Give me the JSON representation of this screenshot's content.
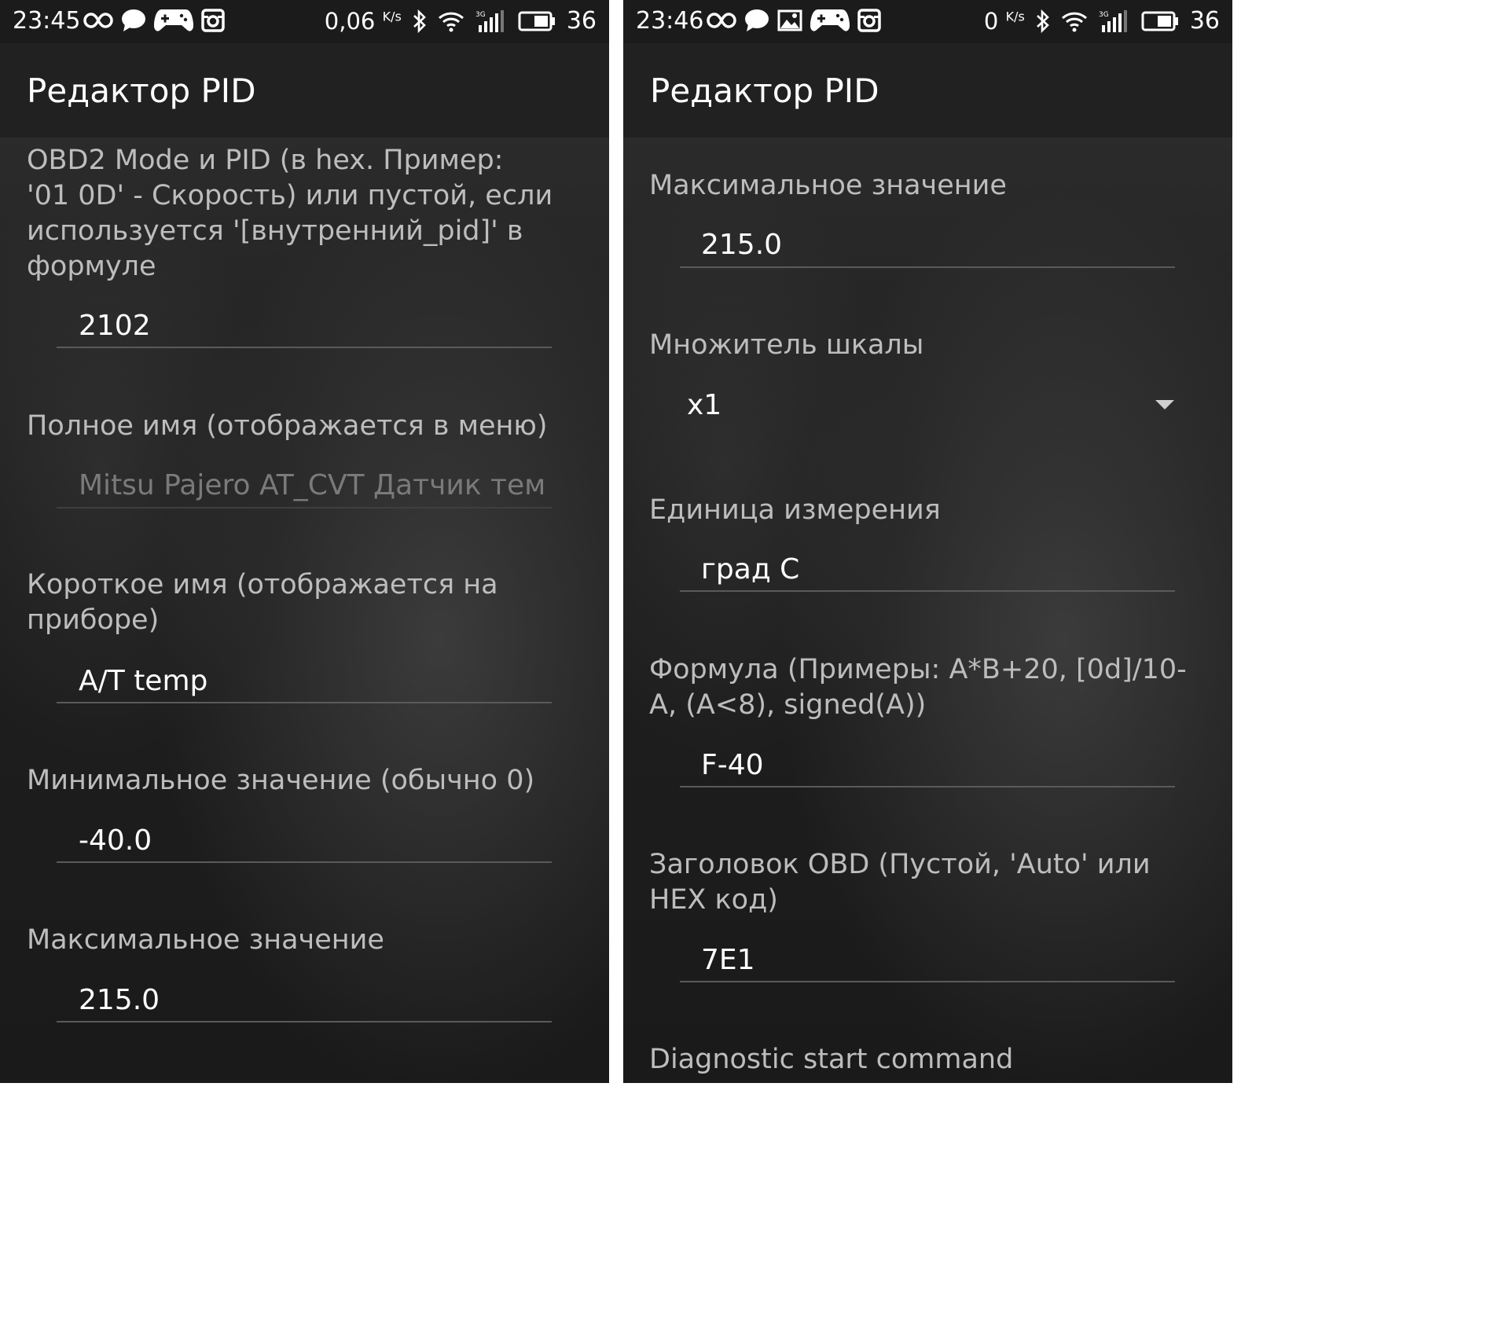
{
  "left": {
    "status": {
      "time": "23:45",
      "net_speed": "0,06",
      "net_unit": "K/s",
      "battery": "36"
    },
    "title": "Редактор PID",
    "fields": [
      {
        "label": "OBD2 Mode и PID (в hex. Пример: '01 0D' - Скорость) или пустой, если используется '[внутренний_pid]' в формуле",
        "value": "2102"
      },
      {
        "label": "Полное имя (отображается в меню)",
        "value": "Mitsu Pajero AT_CVT Датчик тем"
      },
      {
        "label": "Короткое имя (отображается на приборе)",
        "value": "A/T temp"
      },
      {
        "label": "Минимальное значение (обычно 0)",
        "value": "-40.0"
      },
      {
        "label": "Максимальное значение",
        "value": "215.0"
      }
    ]
  },
  "right": {
    "status": {
      "time": "23:46",
      "net_speed": "0",
      "net_unit": "K/s",
      "battery": "36"
    },
    "title": "Редактор PID",
    "fields": [
      {
        "label": "Максимальное значение",
        "value": "215.0"
      },
      {
        "label": "Множитель шкалы",
        "value": "x1"
      },
      {
        "label": "Единица измерения",
        "value": "град С"
      },
      {
        "label": "Формула (Примеры: A*B+20, [0d]/10-A, (A<8), signed(A))",
        "value": "F-40"
      },
      {
        "label": "Заголовок OBD (Пустой, 'Auto' или HEX код)",
        "value": "7E1"
      },
      {
        "label": "Diagnostic start command"
      }
    ]
  },
  "colors": {
    "status_bar": "#1b1b1b",
    "app_bar": "#212121",
    "label_text": "#bdbdbd",
    "value_text": "#ffffff",
    "hint_text": "#7a7a7a",
    "underline": "#5a5a5a"
  },
  "icons": [
    "infinity-icon",
    "chat-bubble-icon",
    "gamepad-icon",
    "instagram-icon",
    "image-icon",
    "bluetooth-icon",
    "wifi-icon",
    "signal-3g-icon",
    "battery-icon",
    "dropdown-arrow-icon"
  ]
}
